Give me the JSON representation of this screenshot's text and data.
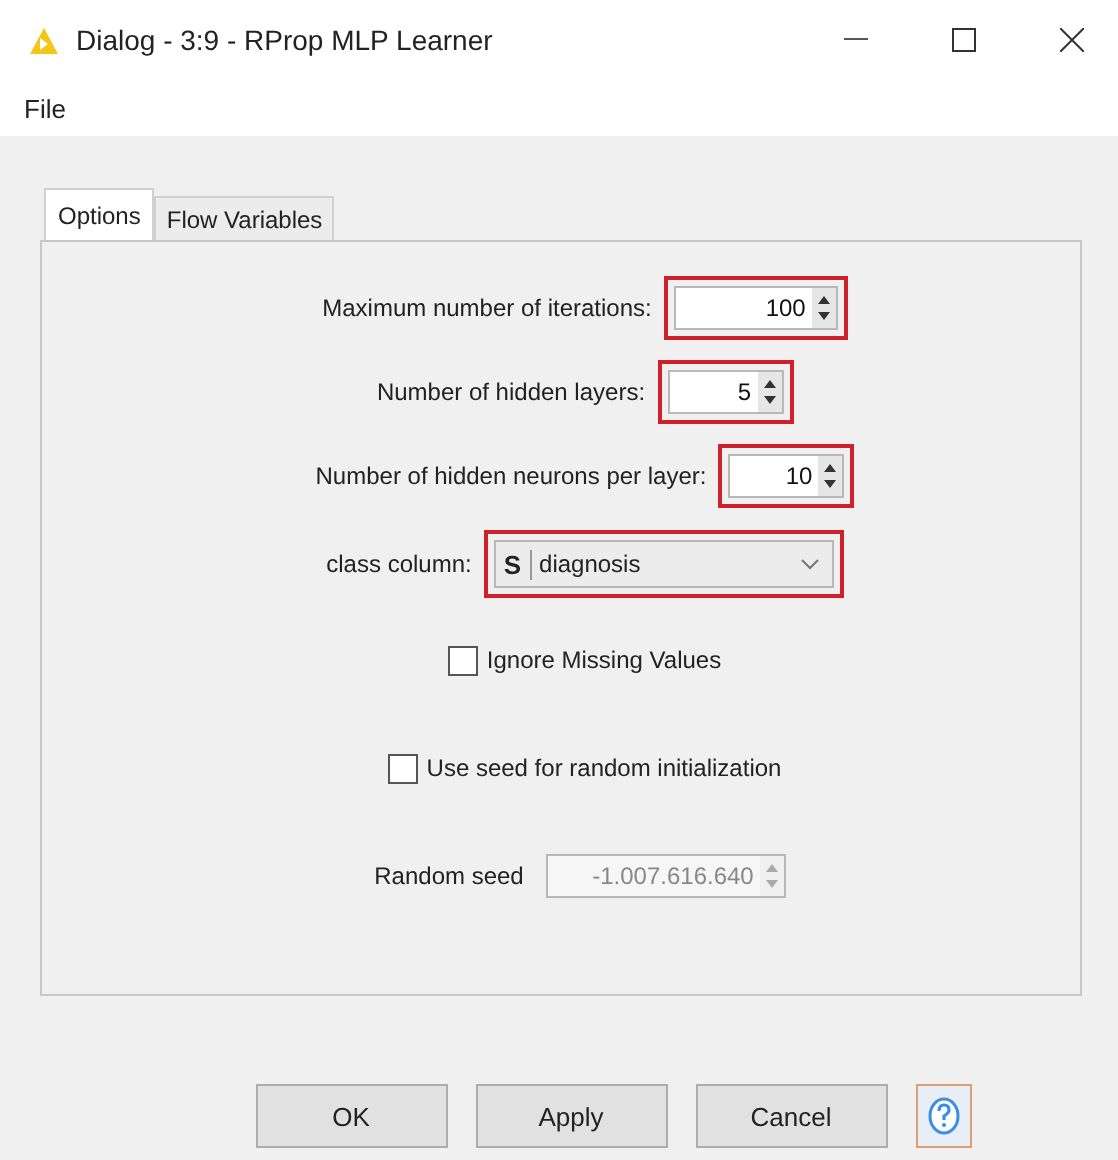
{
  "window": {
    "title": "Dialog - 3:9 - RProp MLP Learner"
  },
  "menu": [
    "File"
  ],
  "tabs": [
    {
      "label": "Options",
      "selected": true
    },
    {
      "label": "Flow Variables",
      "selected": false
    }
  ],
  "fields": [
    {
      "kind": "spinner",
      "label": "Maximum number of iterations:",
      "value": "100",
      "highlighted": true,
      "disabled": false
    },
    {
      "kind": "spinner",
      "label": "Number of hidden layers:",
      "value": "5",
      "highlighted": true,
      "disabled": false
    },
    {
      "kind": "spinner",
      "label": "Number of hidden neurons per layer:",
      "value": "10",
      "highlighted": true,
      "disabled": false
    },
    {
      "kind": "dropdown",
      "label": "class column:",
      "type_badge": "S",
      "value": "diagnosis",
      "highlighted": true
    },
    {
      "kind": "checkbox",
      "label": "Ignore Missing Values",
      "checked": false
    },
    {
      "kind": "checkbox",
      "label": "Use seed for random initialization",
      "checked": false
    },
    {
      "kind": "spinner",
      "label": "Random seed",
      "value": "-1.007.616.640",
      "disabled": true
    }
  ],
  "buttons": [
    "OK",
    "Apply",
    "Cancel"
  ]
}
